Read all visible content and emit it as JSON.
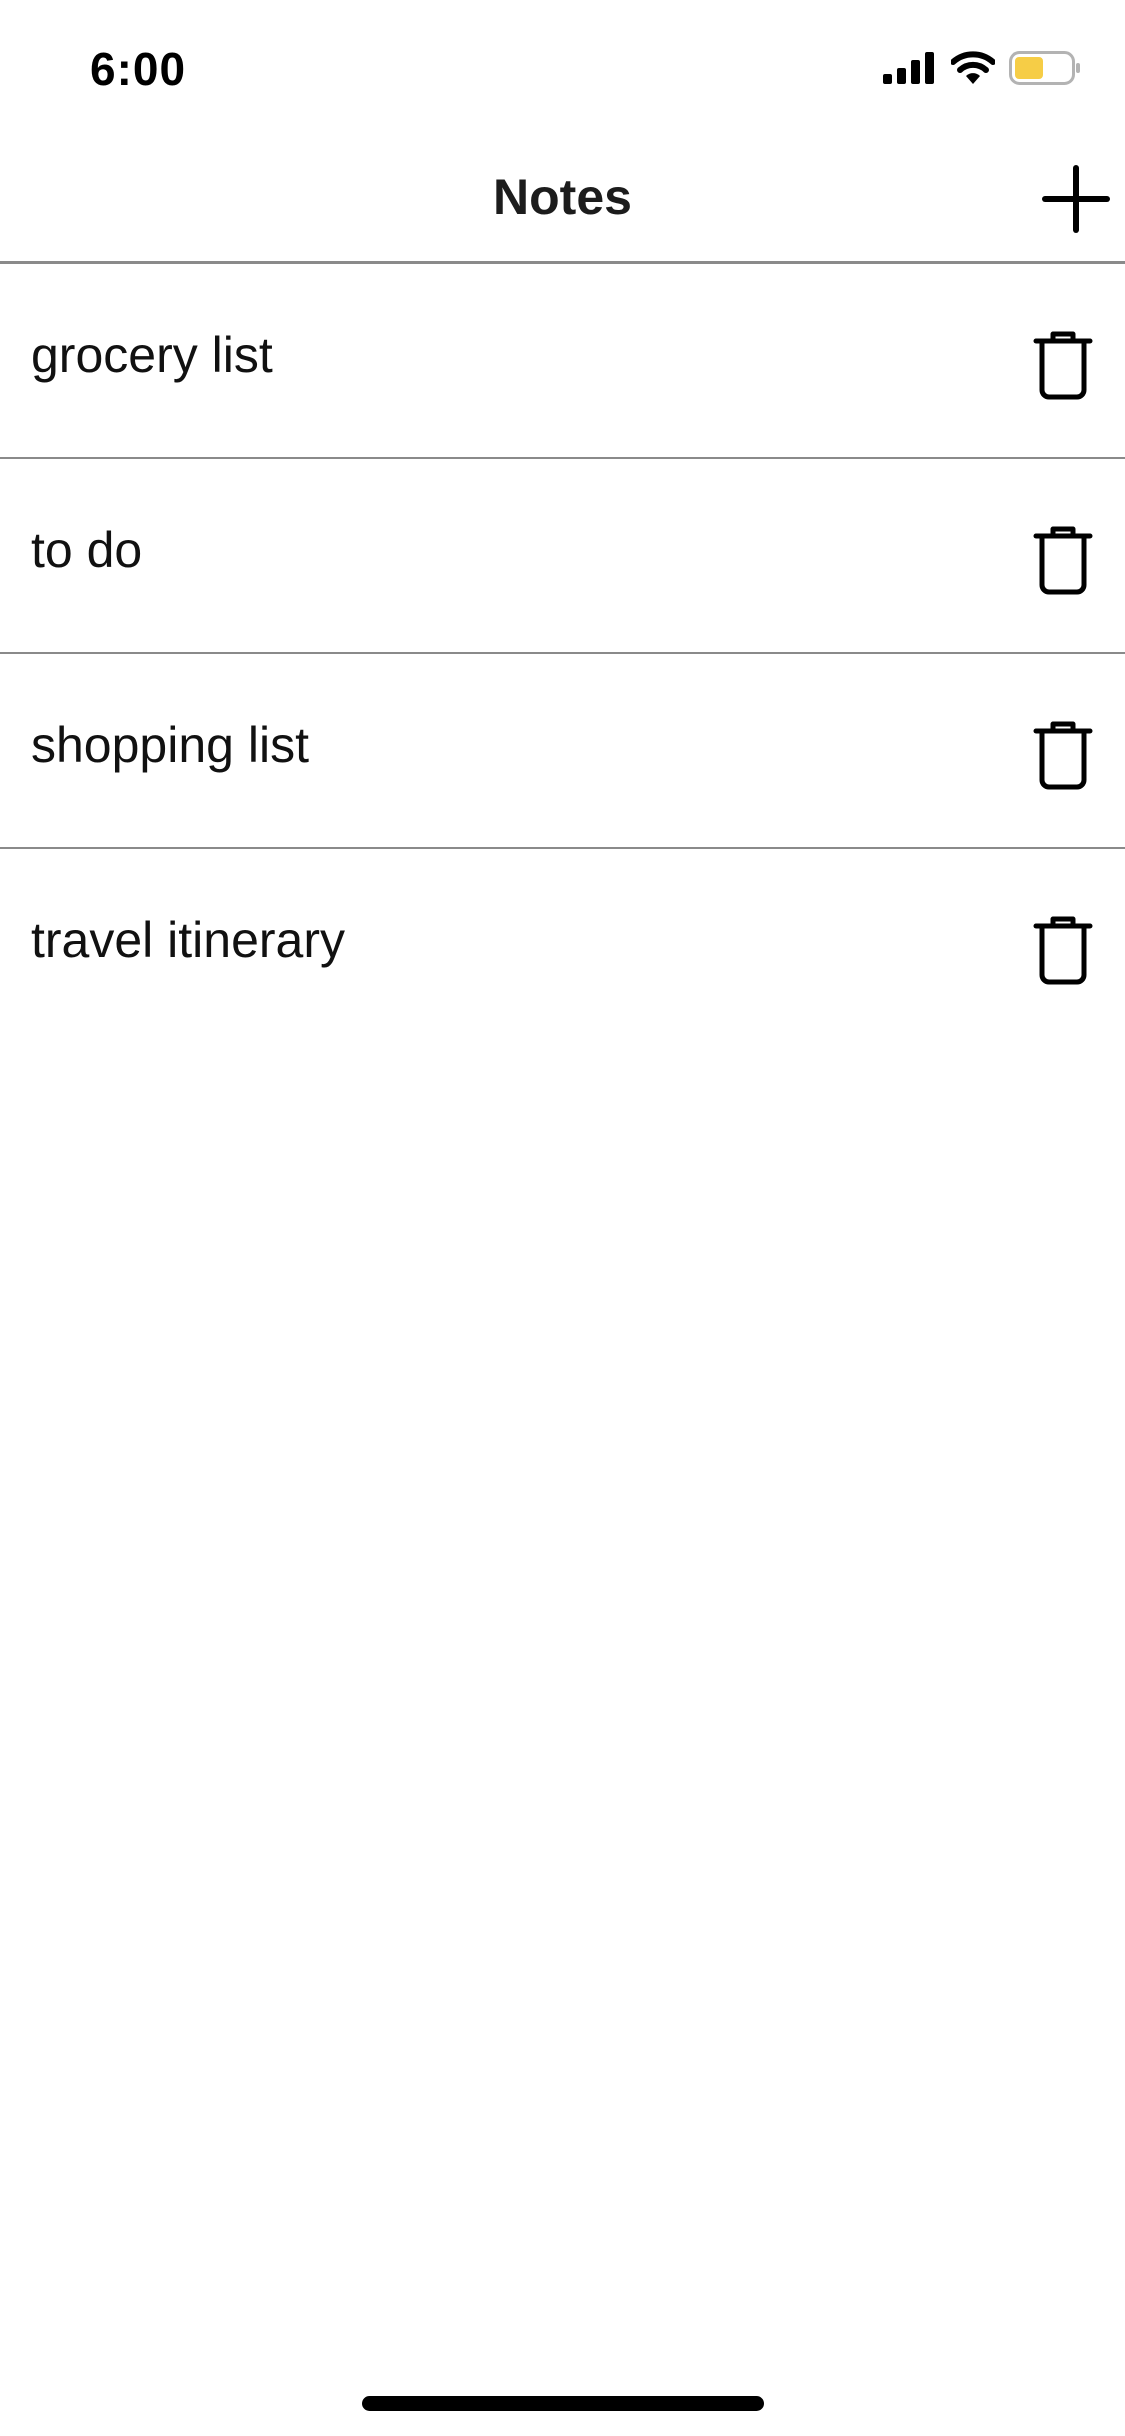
{
  "status_bar": {
    "time": "6:00",
    "icons": [
      "signal-icon",
      "wifi-icon",
      "battery-icon"
    ],
    "battery_color": "#f6cd46"
  },
  "nav": {
    "title": "Notes",
    "add_icon": "plus-icon"
  },
  "notes": [
    {
      "title": "grocery list",
      "delete_icon": "trash-icon"
    },
    {
      "title": "to do",
      "delete_icon": "trash-icon"
    },
    {
      "title": "shopping list",
      "delete_icon": "trash-icon"
    },
    {
      "title": "travel itinerary",
      "delete_icon": "trash-icon"
    }
  ]
}
